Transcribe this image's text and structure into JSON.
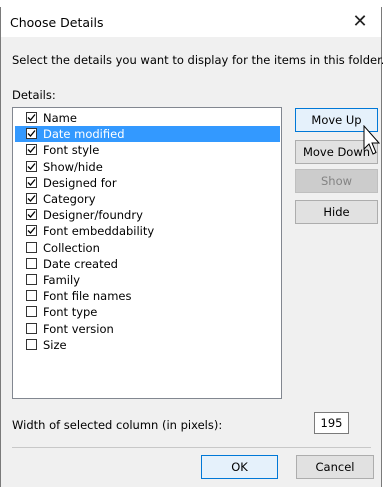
{
  "window": {
    "title": "Choose Details",
    "close_glyph": "✕"
  },
  "instructions": "Select the details you want to display for the items in this folder.",
  "details_label": "Details:",
  "details": [
    {
      "label": "Name",
      "checked": true,
      "selected": false
    },
    {
      "label": "Date modified",
      "checked": true,
      "selected": true
    },
    {
      "label": "Font style",
      "checked": true,
      "selected": false
    },
    {
      "label": "Show/hide",
      "checked": true,
      "selected": false
    },
    {
      "label": "Designed for",
      "checked": true,
      "selected": false
    },
    {
      "label": "Category",
      "checked": true,
      "selected": false
    },
    {
      "label": "Designer/foundry",
      "checked": true,
      "selected": false
    },
    {
      "label": "Font embeddability",
      "checked": true,
      "selected": false
    },
    {
      "label": "Collection",
      "checked": false,
      "selected": false
    },
    {
      "label": "Date created",
      "checked": false,
      "selected": false
    },
    {
      "label": "Family",
      "checked": false,
      "selected": false
    },
    {
      "label": "Font file names",
      "checked": false,
      "selected": false
    },
    {
      "label": "Font type",
      "checked": false,
      "selected": false
    },
    {
      "label": "Font version",
      "checked": false,
      "selected": false
    },
    {
      "label": "Size",
      "checked": false,
      "selected": false
    }
  ],
  "buttons": {
    "move_up": "Move Up",
    "move_down": "Move Down",
    "show": "Show",
    "hide": "Hide",
    "ok": "OK",
    "cancel": "Cancel"
  },
  "width_label": "Width of selected column (in pixels):",
  "width_value": "195",
  "colors": {
    "selection": "#3399ff",
    "accent": "#0078d7"
  }
}
